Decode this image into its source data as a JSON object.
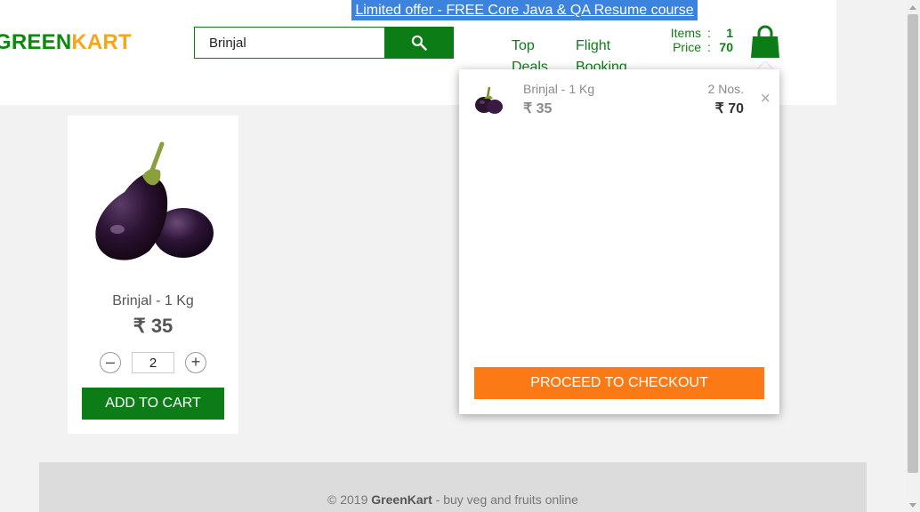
{
  "offer_banner": "Limited offer - FREE Core Java & QA Resume course",
  "brand": {
    "part1": "GREEN",
    "part2": "KART"
  },
  "search": {
    "value": "Brinjal",
    "placeholder": ""
  },
  "nav": {
    "top_deals": "Top Deals",
    "flight_booking": "Flight Booking"
  },
  "cart_info": {
    "items_label": "Items",
    "items_value": "1",
    "price_label": "Price",
    "price_value": "70",
    "separator": ":"
  },
  "cart_preview": {
    "item": {
      "name": "Brinjal - 1 Kg",
      "price": "₹ 35",
      "qty": "2 Nos.",
      "total": "₹ 70",
      "remove": "×"
    },
    "checkout_label": "PROCEED TO CHECKOUT"
  },
  "product": {
    "name": "Brinjal - 1 Kg",
    "price": "₹ 35",
    "quantity": "2",
    "decrement": "–",
    "increment": "+",
    "add_label": "ADD TO CART"
  },
  "footer": {
    "copyright": "© 2019 ",
    "brand": "GreenKart",
    "tagline": " - buy veg and fruits online"
  },
  "colors": {
    "brand_green": "#0c7d16",
    "brand_orange": "#f7a51a",
    "checkout_orange": "#fb7a15",
    "banner_blue": "#3b83dc"
  },
  "icons": [
    "search-icon",
    "cart-bag-icon",
    "close-icon",
    "eggplant-image"
  ]
}
